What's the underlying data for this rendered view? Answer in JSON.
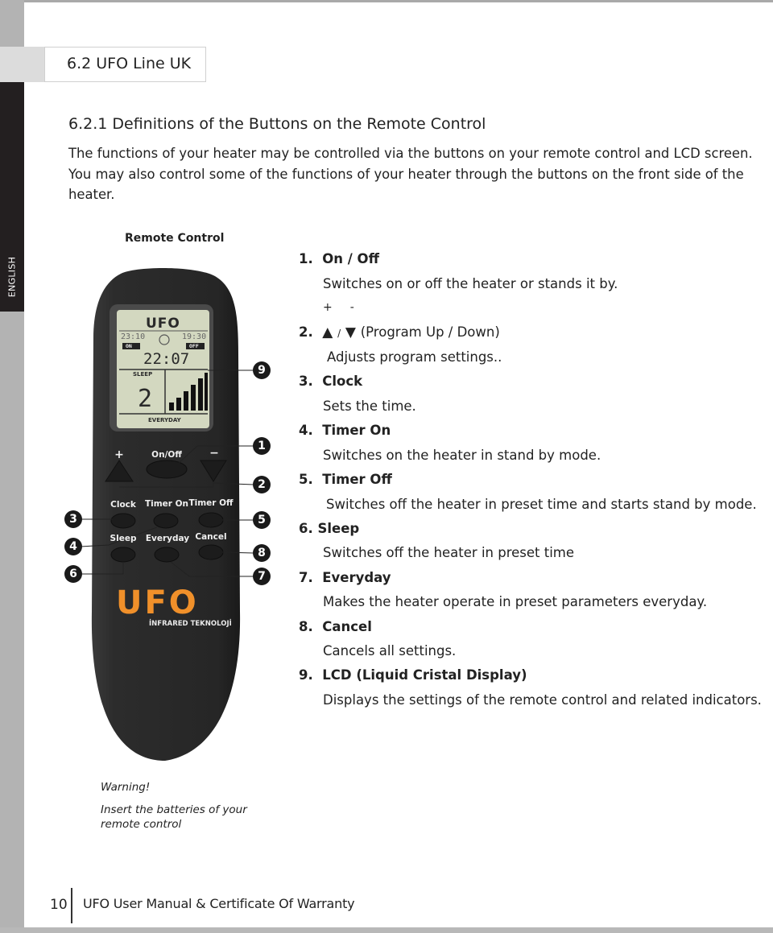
{
  "sidebar": {
    "language_tab": "ENGLISH"
  },
  "section": {
    "title": "6.2  UFO Line UK"
  },
  "subsection": {
    "title": "6.2.1 Definitions of the Buttons on the Remote Control"
  },
  "intro": {
    "text": "The functions of your heater may be controlled via the buttons on your remote control and LCD screen. You may also control some of the functions of your heater through the buttons on the front side of the heater."
  },
  "figure": {
    "caption": "Remote Control",
    "lcd": {
      "brand": "UFO",
      "timer_on_time": "23:10",
      "timer_off_time": "19:30",
      "on_badge": "ON",
      "off_badge": "OFF",
      "clock_time": "22:07",
      "sleep_label": "SLEEP",
      "sleep_value": "2",
      "power_level_bars": 6,
      "mode_label": "EVERYDAY"
    },
    "buttons": {
      "plus": "+",
      "minus": "−",
      "on_off": "On/Off",
      "clock": "Clock",
      "timer_on": "Timer On",
      "timer_off": "Timer Off",
      "sleep": "Sleep",
      "everyday": "Everyday",
      "cancel": "Cancel"
    },
    "logo": "UFO",
    "tagline": "İNFRARED TEKNOLOJİ",
    "callouts": [
      "1",
      "2",
      "3",
      "4",
      "5",
      "6",
      "7",
      "8",
      "9"
    ]
  },
  "definitions": {
    "plus_minus": {
      "plus": "+",
      "minus": "-"
    },
    "items": [
      {
        "number": "1.",
        "title": "On / Off",
        "desc": "Switches on or off the heater or stands it by."
      },
      {
        "number": "2.",
        "up_arrow": "▲",
        "separator": "/",
        "down_arrow": "▼",
        "title": "(Program Up / Down)",
        "desc": "Adjusts program settings.."
      },
      {
        "number": "3.",
        "title": "Clock",
        "desc": "Sets the time."
      },
      {
        "number": "4.",
        "title": "Timer On",
        "desc": "Switches on the heater in stand by mode."
      },
      {
        "number": "5.",
        "title": "Timer Off",
        "desc": "Switches off the heater in preset time and starts stand by mode."
      },
      {
        "number": "6.",
        "title": "Sleep",
        "desc": "Switches off the heater in preset time"
      },
      {
        "number": "7.",
        "title": "Everyday",
        "desc": "Makes the heater operate in preset parameters everyday."
      },
      {
        "number": "8.",
        "title": "Cancel",
        "desc": "Cancels all settings."
      },
      {
        "number": "9.",
        "title": "LCD (Liquid Cristal Display)",
        "desc": "Displays the settings of the remote control and related indicators."
      }
    ]
  },
  "warning": {
    "title": "Warning!",
    "body": "Insert the batteries of your remote control"
  },
  "footer": {
    "page_number": "10",
    "title": "UFO User Manual & Certificate Of Warranty"
  },
  "colors": {
    "brand_orange": "#f0902a",
    "sidebar_dark": "#231f20",
    "remote_body": "#2b2b2b",
    "lcd_background": "#d3d8c0"
  }
}
